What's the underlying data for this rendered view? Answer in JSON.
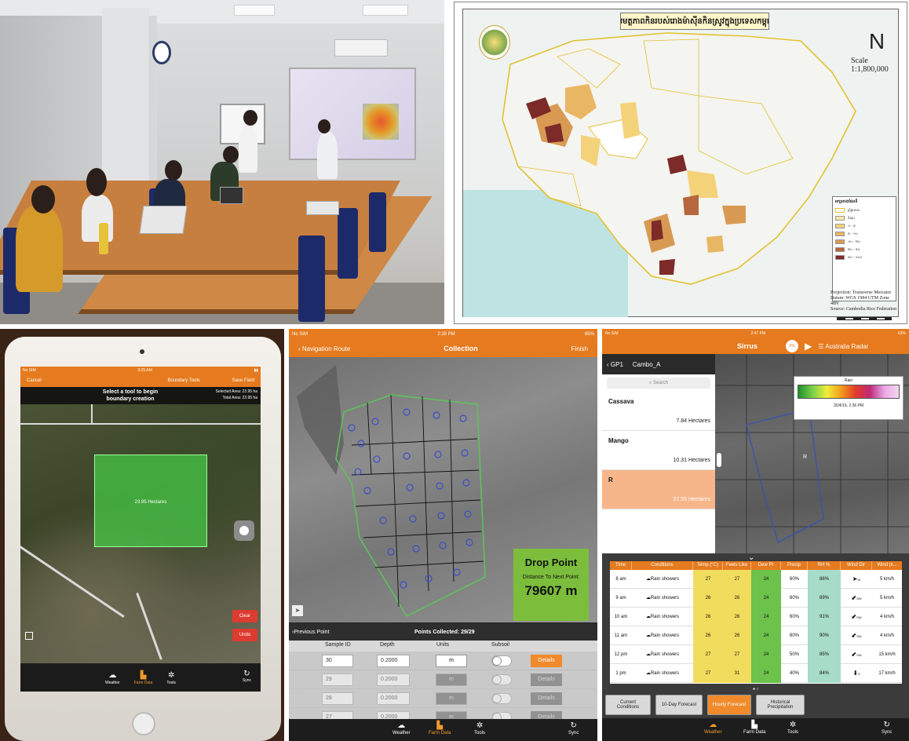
{
  "map": {
    "title": "សមត្ថភាពកិនរបស់រោងម៉ាស៊ីនកិនស្រូវក្នុងប្រទេសកម្ពុជា",
    "scale": "Scale 1:1,800,000",
    "legend_title": "អក្សរតាងផែនទី",
    "legend_items": [
      "ព្រំប្រទេស",
      "ចំណុះ",
      "១ - ៥",
      "៥ - ១០",
      "១០ - ២០",
      "២០ - ៥០",
      "៥០ - ១០០"
    ],
    "legend_colors": [
      "#ffffff",
      "#f7e7a3",
      "#f4d27a",
      "#e9b663",
      "#d89a52",
      "#b5673e",
      "#7d2a28"
    ],
    "notes": [
      "Projection: Transverse Mercator",
      "Datum: WGS 1984 UTM Zone 48N",
      "Source: Cambodia Rice Federation"
    ],
    "scalebar": "Kilometers",
    "compass": "N"
  },
  "tablet": {
    "status_left": "No SIM",
    "status_time": "9:25 AM",
    "nav_left": "Cancel",
    "nav_center": "Boundary Tools",
    "nav_right": "Save Field",
    "prompt": "Select a tool to begin boundary creation",
    "selected_area_label": "Selected Area:",
    "selected_area": "23.95 ha",
    "total_area_label": "Total Area:",
    "total_area": "23.95 ha",
    "field_label": "23.95 Hectares",
    "clear": "Clear",
    "undo": "Undo",
    "tabs": [
      "Weather",
      "Farm Data",
      "Tools"
    ],
    "sync": "Sync"
  },
  "collection": {
    "status_left": "No SIM",
    "status_time": "2:39 PM",
    "status_right": "65%",
    "back": "Navigation Route",
    "title": "Collection",
    "finish": "Finish",
    "drop_point": "Drop Point",
    "distance_label": "Distance To Next Point:",
    "distance": "79607 m",
    "prev_point": "Previous Point",
    "points_collected": "Points Collected: 29/29",
    "headers": [
      "Sample ID",
      "Depth",
      "Units",
      "Subsoil"
    ],
    "rows": [
      {
        "id": "30",
        "depth": "0.2000",
        "unit": "m",
        "details": "Details"
      },
      {
        "id": "29",
        "depth": "0.2000",
        "unit": "m",
        "details": "Details"
      },
      {
        "id": "28",
        "depth": "0.2000",
        "unit": "m",
        "details": "Details"
      },
      {
        "id": "27",
        "depth": "0.2000",
        "unit": "m",
        "details": "Details"
      }
    ],
    "tabs": [
      "Weather",
      "Farm Data",
      "Tools"
    ],
    "sync": "Sync"
  },
  "weather": {
    "status_left": "No SIM",
    "status_time": "2:47 PM",
    "status_right": "63%",
    "title": "Sirrus",
    "radar_pct": "0%",
    "radar_label": "Australia Radar",
    "back": "GP1",
    "farm": "Cambo_A",
    "search": "Search",
    "fields": [
      {
        "name": "Cassava",
        "area": "7.84 Hectares"
      },
      {
        "name": "Mango",
        "area": "10.31 Hectares"
      },
      {
        "name": "R",
        "area": "27.55 Hectares"
      }
    ],
    "rain_title": "Rain",
    "rain_time": "3/24/16, 2:36 PM",
    "table_headers": [
      "Time",
      "Conditions",
      "Temp (°C)",
      "Feels Like",
      "Dew Pt",
      "Precip",
      "RH %",
      "Wind Dir",
      "Wind (k..."
    ],
    "table_rows": [
      {
        "time": "8 am",
        "cond": "Rain showers",
        "temp": "27",
        "feels": "27",
        "dew": "24",
        "precip": "60%",
        "rh": "86%",
        "dir": "W",
        "wind": "5 km/h"
      },
      {
        "time": "9 am",
        "cond": "Rain showers",
        "temp": "26",
        "feels": "26",
        "dew": "24",
        "precip": "60%",
        "rh": "89%",
        "dir": "SW",
        "wind": "5 km/h"
      },
      {
        "time": "10 am",
        "cond": "Rain showers",
        "temp": "26",
        "feels": "26",
        "dew": "24",
        "precip": "60%",
        "rh": "91%",
        "dir": "SW",
        "wind": "4 km/h"
      },
      {
        "time": "11 am",
        "cond": "Rain showers",
        "temp": "26",
        "feels": "26",
        "dew": "24",
        "precip": "60%",
        "rh": "90%",
        "dir": "SW",
        "wind": "4 km/h"
      },
      {
        "time": "12 pm",
        "cond": "Rain showers",
        "temp": "27",
        "feels": "27",
        "dew": "24",
        "precip": "50%",
        "rh": "85%",
        "dir": "SW",
        "wind": "15 km/h"
      },
      {
        "time": "1 pm",
        "cond": "Rain showers",
        "temp": "27",
        "feels": "31",
        "dew": "24",
        "precip": "40%",
        "rh": "84%",
        "dir": "S",
        "wind": "17 km/h"
      }
    ],
    "buttons": [
      "Current Conditions",
      "10-Day Forecast",
      "Hourly Forecast",
      "Historical Precipitation"
    ],
    "tabs": [
      "Weather",
      "Farm Data",
      "Tools"
    ],
    "sync": "Sync",
    "colors": {
      "accent": "#e67a1e",
      "temp": "#f2dc5d",
      "dew": "#6cc24a",
      "rh": "#a7dcc8"
    }
  }
}
